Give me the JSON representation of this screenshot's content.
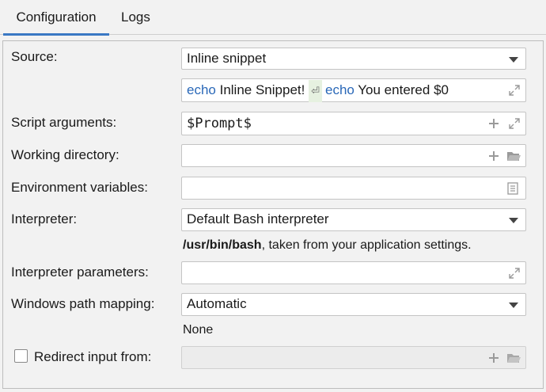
{
  "tabs": [
    {
      "label": "Configuration",
      "active": true
    },
    {
      "label": "Logs",
      "active": false
    }
  ],
  "form": {
    "source": {
      "label": "Source:",
      "value": "Inline snippet"
    },
    "snippet": {
      "kw1": "echo",
      "text1": " Inline Snippet! ",
      "newline_glyph": "⏎",
      "kw2": "echo",
      "text2": " You entered $0"
    },
    "script_args": {
      "label": "Script arguments:",
      "value": "$Prompt$"
    },
    "working_dir": {
      "label": "Working directory:",
      "value": ""
    },
    "env_vars": {
      "label": "Environment variables:",
      "value": ""
    },
    "interpreter": {
      "label": "Interpreter:",
      "value": "Default Bash interpreter",
      "hint_bold": "/usr/bin/bash",
      "hint_rest": ", taken from your application settings."
    },
    "interpreter_params": {
      "label": "Interpreter parameters:",
      "value": ""
    },
    "path_mapping": {
      "label": "Windows path mapping:",
      "value": "Automatic",
      "hint": "None"
    },
    "redirect": {
      "label": "Redirect input from:",
      "checked": false,
      "value": ""
    }
  },
  "colors": {
    "accent": "#3a78c4",
    "keyword": "#2a68b8"
  }
}
